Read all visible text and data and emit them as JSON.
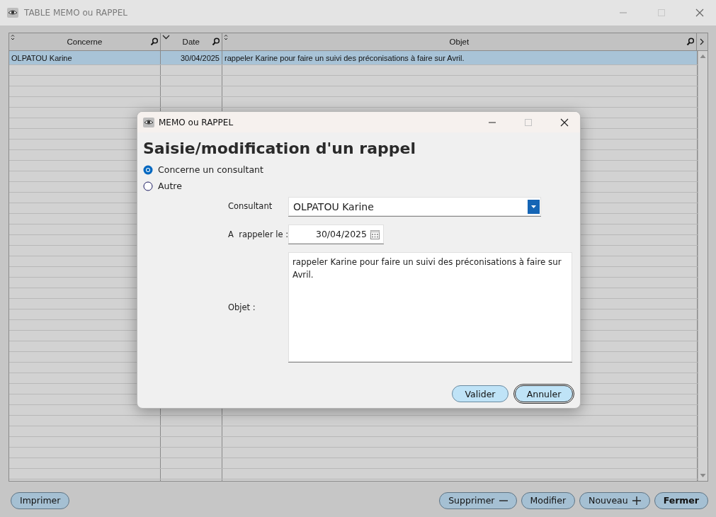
{
  "main_window": {
    "title": "TABLE MEMO ou RAPPEL",
    "table": {
      "columns": [
        {
          "label": "Concerne",
          "sorted_descending": false,
          "align_right": false
        },
        {
          "label": "Date",
          "sorted_descending": true,
          "align_right": true
        },
        {
          "label": "Objet",
          "sorted_descending": false,
          "align_right": false
        }
      ],
      "rows": [
        {
          "cells": [
            "OLPATOU Karine",
            "30/04/2025",
            "rappeler Karine pour faire un suivi des préconisations à faire sur Avril."
          ],
          "selected": true
        }
      ]
    },
    "buttons": [
      {
        "label": "Imprimer",
        "kind": "plain"
      },
      {
        "label": "Supprimer",
        "kind": "minus"
      },
      {
        "label": "Modifier",
        "kind": "plain"
      },
      {
        "label": "Nouveau",
        "kind": "plus"
      },
      {
        "label": "Fermer",
        "kind": "default"
      }
    ]
  },
  "dialog": {
    "title": "MEMO ou RAPPEL",
    "heading": "Saisie/modification d'un rappel",
    "radios": [
      {
        "label": "Concerne un consultant",
        "selected": true
      },
      {
        "label": "Autre",
        "selected": false
      }
    ],
    "consultant": {
      "label": "Consultant",
      "value": "OLPATOU Karine"
    },
    "date": {
      "label": "A  rappeler le :",
      "value": "30/04/2025"
    },
    "objet": {
      "label": "Objet :",
      "value": "rappeler Karine pour faire un suivi des préconisations à faire sur Avril."
    },
    "buttons": [
      {
        "label": "Valider",
        "focused": false
      },
      {
        "label": "Annuler",
        "focused": true
      }
    ]
  }
}
